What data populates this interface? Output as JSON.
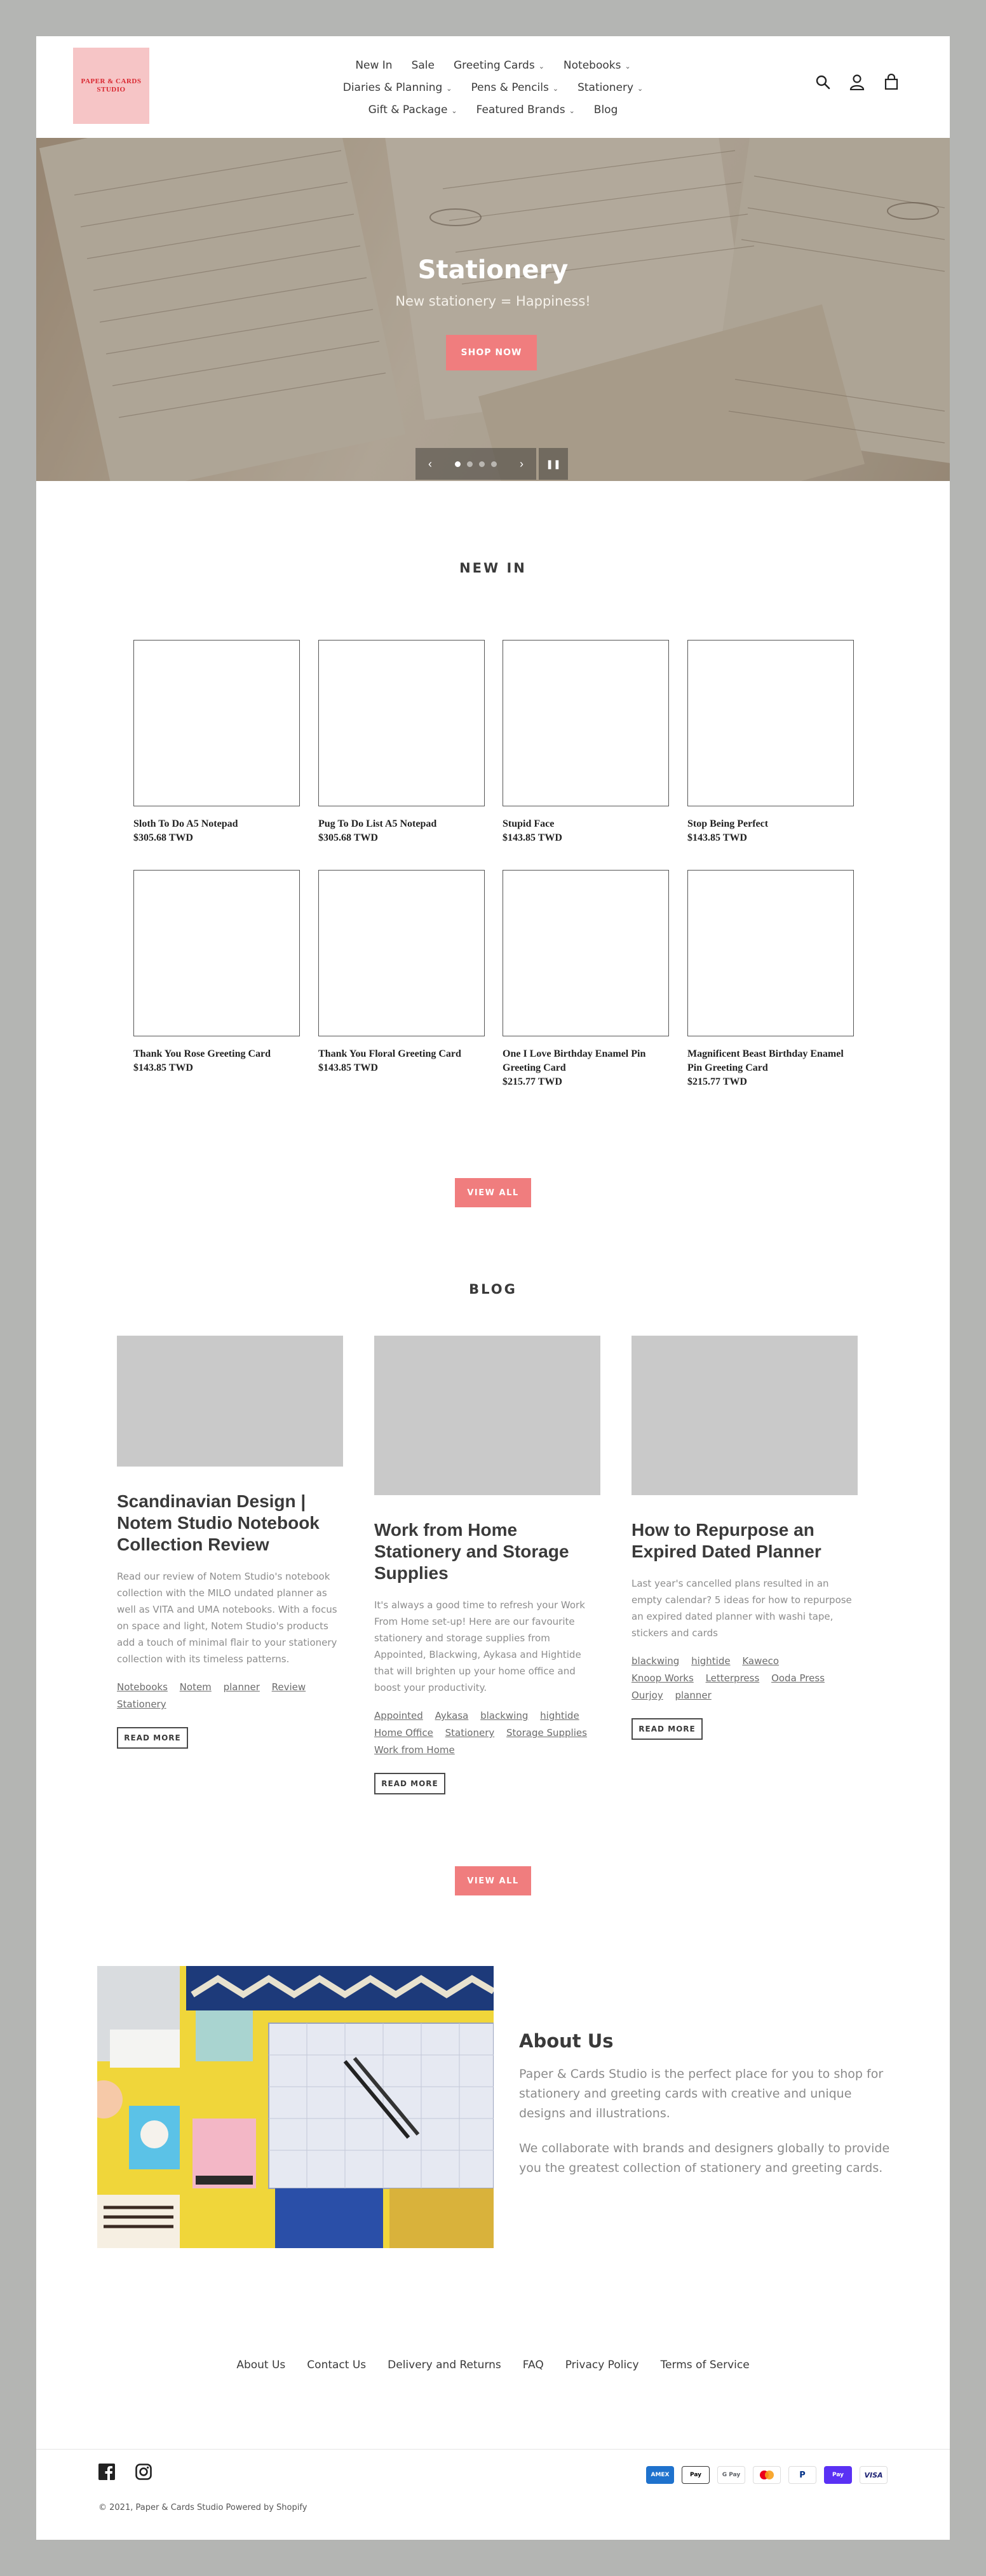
{
  "brand": {
    "logo_lines": [
      "PAPER & CARDS",
      "STUDIO"
    ],
    "accent": "#f07d7e"
  },
  "nav": {
    "row1": [
      {
        "label": "New In",
        "dropdown": false
      },
      {
        "label": "Sale",
        "dropdown": false
      },
      {
        "label": "Greeting Cards",
        "dropdown": true
      },
      {
        "label": "Notebooks",
        "dropdown": true
      }
    ],
    "row2": [
      {
        "label": "Diaries & Planning",
        "dropdown": true
      },
      {
        "label": "Pens & Pencils",
        "dropdown": true
      },
      {
        "label": "Stationery",
        "dropdown": true
      }
    ],
    "row3": [
      {
        "label": "Gift & Package",
        "dropdown": true
      },
      {
        "label": "Featured Brands",
        "dropdown": true
      },
      {
        "label": "Blog",
        "dropdown": false
      }
    ]
  },
  "header_icons": [
    "search-icon",
    "account-icon",
    "cart-icon"
  ],
  "hero": {
    "title": "Stationery",
    "subtitle": "New stationery = Happiness!",
    "button": "SHOP NOW",
    "slides": 4,
    "active_slide": 1
  },
  "new_in": {
    "title": "NEW IN",
    "products": [
      {
        "name": "Sloth To Do A5 Notepad",
        "price": "$305.68 TWD"
      },
      {
        "name": "Pug To Do List A5 Notepad",
        "price": "$305.68 TWD"
      },
      {
        "name": "Stupid Face",
        "price": "$143.85 TWD"
      },
      {
        "name": "Stop Being Perfect",
        "price": "$143.85 TWD"
      },
      {
        "name": "Thank You Rose Greeting Card",
        "price": "$143.85 TWD"
      },
      {
        "name": "Thank You Floral Greeting Card",
        "price": "$143.85 TWD"
      },
      {
        "name": "One I Love Birthday Enamel Pin Greeting Card",
        "price": "$215.77 TWD"
      },
      {
        "name": "Magnificent Beast Birthday Enamel Pin Greeting Card",
        "price": "$215.77 TWD"
      }
    ],
    "view_all": "VIEW ALL"
  },
  "blog": {
    "title": "BLOG",
    "posts": [
      {
        "title": "Scandinavian Design | Notem Studio Notebook Collection Review",
        "excerpt": "Read our review of Notem Studio's notebook collection with the MILO undated planner as well as VITA and UMA notebooks. With a focus on space and light, Notem Studio's products add a touch of minimal flair to your stationery collection with its timeless patterns.",
        "tags": [
          "Notebooks",
          "Notem",
          "planner",
          "Review",
          "Stationery"
        ],
        "button": "READ MORE"
      },
      {
        "title": "Work from Home Stationery and Storage Supplies",
        "excerpt": "It's always a good time to refresh your Work From Home set-up! Here are our favourite stationery and storage supplies from Appointed, Blackwing, Aykasa and Hightide that will brighten up your home office and boost your productivity.",
        "tags": [
          "Appointed",
          "Aykasa",
          "blackwing",
          "hightide",
          "Home Office",
          "Stationery",
          "Storage Supplies",
          "Work from Home"
        ],
        "button": "READ MORE"
      },
      {
        "title": "How to Repurpose an Expired Dated Planner",
        "excerpt": "Last year's cancelled plans resulted in an empty calendar? 5 ideas for how to repurpose an expired dated planner with washi tape, stickers and cards",
        "tags": [
          "blackwing",
          "hightide",
          "Kaweco",
          "Knoop Works",
          "Letterpress",
          "Ooda Press",
          "Ourjoy",
          "planner"
        ],
        "button": "READ MORE"
      }
    ],
    "view_all": "VIEW ALL"
  },
  "about": {
    "title": "About Us",
    "p1": "Paper & Cards Studio is the perfect place for you to shop for stationery and greeting cards with creative and unique designs and illustrations.",
    "p2": "We collaborate with brands and designers globally to provide you the greatest collection of stationery and greeting cards."
  },
  "footer": {
    "links": [
      "About Us",
      "Contact Us",
      "Delivery and Returns",
      "FAQ",
      "Privacy Policy",
      "Terms of Service"
    ],
    "social": [
      "facebook-icon",
      "instagram-icon"
    ],
    "copyright": "© 2021, Paper & Cards Studio Powered by Shopify",
    "payments": [
      {
        "label": "AMEX",
        "bg": "#1f72cd",
        "fg": "#ffffff"
      },
      {
        "label": "Pay",
        "bg": "#ffffff",
        "fg": "#000000"
      },
      {
        "label": "G Pay",
        "bg": "#ffffff",
        "fg": "#5f6368"
      },
      {
        "label": "MC",
        "bg": "#ffffff",
        "fg": "#eb001b"
      },
      {
        "label": "P",
        "bg": "#ffffff",
        "fg": "#003087"
      },
      {
        "label": "Pay",
        "bg": "#5a31f4",
        "fg": "#ffffff"
      },
      {
        "label": "VISA",
        "bg": "#ffffff",
        "fg": "#1a1f71"
      }
    ]
  }
}
